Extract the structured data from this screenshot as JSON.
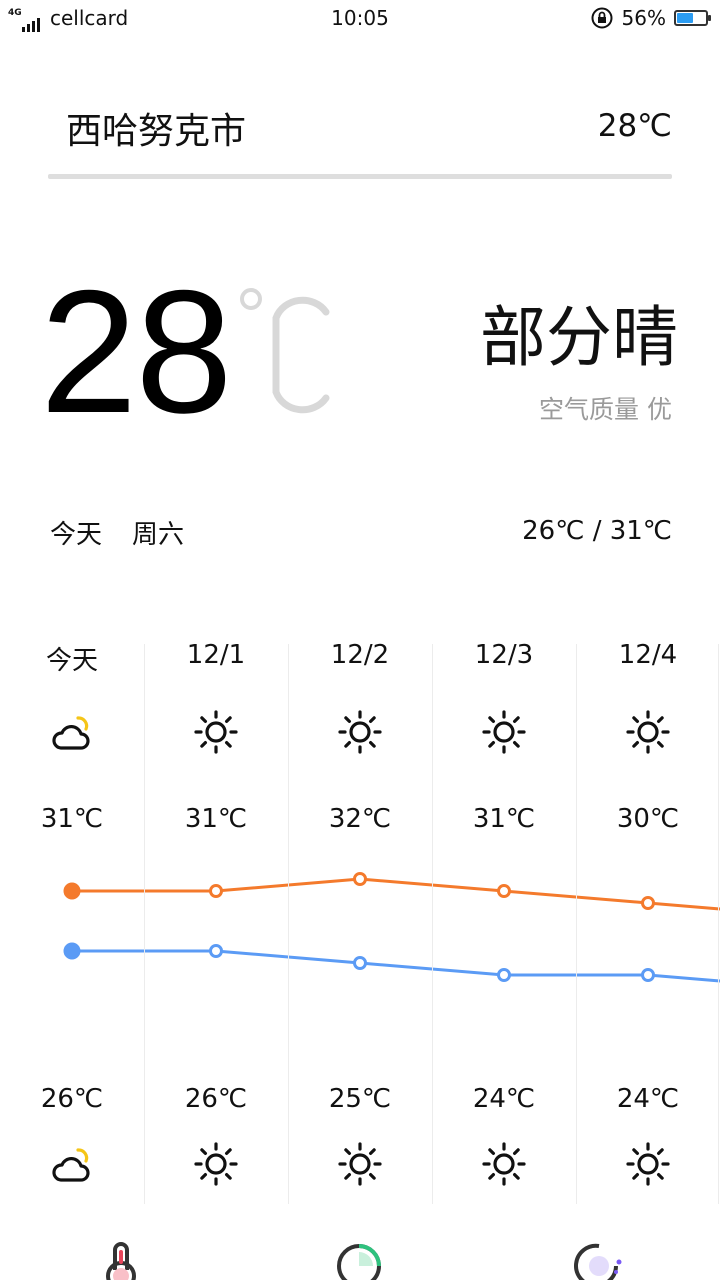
{
  "status_bar": {
    "network": "4G",
    "carrier": "cellcard",
    "time": "10:05",
    "battery": "56%",
    "battery_level": 0.56,
    "lock_icon": "rotation-lock-icon"
  },
  "header": {
    "city": "西哈努克市",
    "temp": "28℃"
  },
  "current": {
    "temp": "28",
    "unit": "℃",
    "condition": "部分晴",
    "air_quality": "空气质量 优",
    "today": "今天",
    "weekday": "周六",
    "range": "26℃ / 31℃"
  },
  "forecast": {
    "days": [
      {
        "label": "今天",
        "icon": "partly-cloudy-icon",
        "high": "31℃",
        "low": "26℃"
      },
      {
        "label": "12/1",
        "icon": "sun-icon",
        "high": "31℃",
        "low": "26℃"
      },
      {
        "label": "12/2",
        "icon": "sun-icon",
        "high": "32℃",
        "low": "25℃"
      },
      {
        "label": "12/3",
        "icon": "sun-icon",
        "high": "31℃",
        "low": "24℃"
      },
      {
        "label": "12/4",
        "icon": "sun-icon",
        "high": "30℃",
        "low": "24℃"
      }
    ]
  },
  "chart_data": {
    "type": "line",
    "categories": [
      "今天",
      "12/1",
      "12/2",
      "12/3",
      "12/4"
    ],
    "series": [
      {
        "values": [
          31,
          31,
          32,
          31,
          30
        ],
        "color": "#f47a2c"
      },
      {
        "values": [
          26,
          26,
          25,
          24,
          24
        ],
        "color": "#5b9bf5"
      }
    ]
  },
  "colors": {
    "high_line": "#f47a2c",
    "low_line": "#5b9bf5",
    "sun_accent": "#f5c518"
  },
  "bottom_bar": {
    "icons": [
      "thermometer-icon",
      "progress-ring-icon",
      "orb-icon"
    ]
  }
}
